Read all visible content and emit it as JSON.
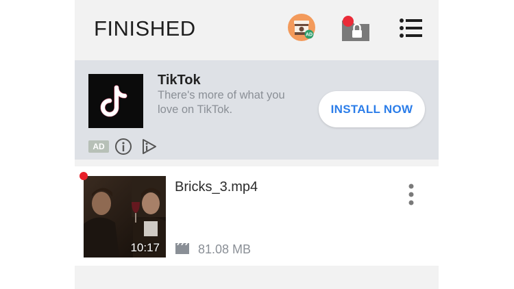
{
  "header": {
    "title": "FINISHED",
    "ad_icon": "ad-gift-icon",
    "lock_icon": "private-folder-lock-icon",
    "menu_icon": "menu-list-icon"
  },
  "ad": {
    "app_name": "TikTok",
    "description": "There's more of what you love on TikTok.",
    "install_label": "INSTALL NOW",
    "badge": "AD",
    "info_icon": "info-icon",
    "adchoices_icon": "adchoices-icon",
    "accent_color": "#2b7de9"
  },
  "files": [
    {
      "name": "Bricks_3.mp4",
      "duration": "10:17",
      "size": "81.08 MB",
      "is_new": true
    }
  ]
}
